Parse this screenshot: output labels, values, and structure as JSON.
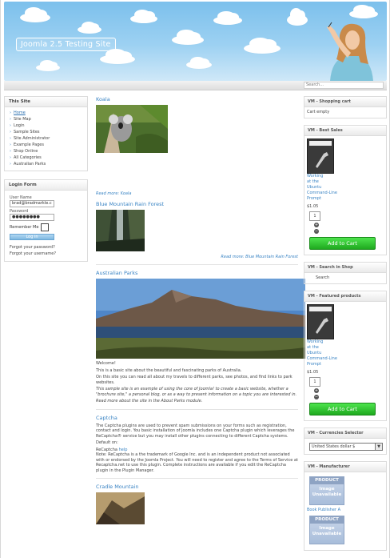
{
  "header": {
    "site_title": "Joomla 2.5 Testing Site",
    "search_placeholder": "Search..."
  },
  "left_sidebar": {
    "this_site": {
      "title": "This Site",
      "items": [
        "Home",
        "Site Map",
        "Login",
        "Sample Sites",
        "Site Administrator",
        "Example Pages",
        "Shop Online",
        "All Categories",
        "Australian Parks"
      ]
    },
    "login_form": {
      "title": "Login Form",
      "username_label": "User Name",
      "username_value": "brad@bradmarkle.c",
      "password_label": "Password",
      "password_value": "●●●●●●●●",
      "remember_label": "Remember Me",
      "login_button": "Log in",
      "forgot_password": "Forgot your password?",
      "forgot_username": "Forgot your username?"
    }
  },
  "main": {
    "koala": {
      "title": "Koala",
      "readmore": "Read more: Koala"
    },
    "blue_mountain": {
      "title": "Blue Mountain Rain Forest",
      "readmore": "Read more: Blue Mountain Rain Forest"
    },
    "australian_parks": {
      "title": "Australian Parks",
      "p1": "Welcome!",
      "p2": "This is a basic site about the beautiful and fascinating parks of Australia.",
      "p3": "On this site you can read all about my travels to different parks, see photos, and find links to park websites.",
      "p4": "This sample site is an example of using the core of Joomla! to create a basic website, whether a \"brochure site,\" a personal blog, or as a way to present information on a topic you are interested in.",
      "p5": "Read more about the site in the About Parks module."
    },
    "captcha": {
      "title": "Captcha",
      "p1": "The Captcha plugins are used to prevent spam submissions on your forms such as registration, contact and login. You basic installation of Joomla includes one Captcha plugin which leverages the ReCaptcha® service but you may install other plugins connecting to different Captcha systems.",
      "p2": "Default on:",
      "p3_label": "ReCaptcha",
      "p3_link": "help",
      "p4": "Note: ReCaptcha is a the trademark of Google Inc. and is an independent product not associated with or endorsed by the Joomla Project. You will need to register and agree to the Terms of Service at Recaptcha.net to use this plugin. Complete instructions are available if you edit the ReCaptcha plugin in the Plugin Manager."
    },
    "cradle_mountain": {
      "title": "Cradle Mountain"
    }
  },
  "right_sidebar": {
    "cart": {
      "title": "VM - Shopping cart",
      "status": "Cart empty"
    },
    "best_sales": {
      "title": "VM - Best Sales",
      "product_name_lines": [
        "Working",
        "at the",
        "Ubuntu",
        "Command-Line",
        "Prompt"
      ],
      "price": "$1.05",
      "qty": "1",
      "add_to_cart": "Add to Cart"
    },
    "search_shop": {
      "title": "VM - Search in Shop",
      "label": "Search"
    },
    "featured": {
      "title": "VM - Featured products",
      "product_name_lines": [
        "Working",
        "at the",
        "Ubuntu",
        "Command-Line",
        "Prompt"
      ],
      "price": "$1.05",
      "qty": "1",
      "add_to_cart": "Add to Cart"
    },
    "currencies": {
      "title": "VM - Currencies Selector",
      "selected": "United States dollar $"
    },
    "manufacturer": {
      "title": "VM - Manufacturer",
      "noimg_top": "PRODUCT",
      "noimg_line1": "Image",
      "noimg_line2": "Unavailable",
      "publisher_a": "Book Publisher A"
    }
  },
  "colors": {
    "link": "#3a84c4",
    "header_sky": "#9dd1f2",
    "add_to_cart": "#2fc02f"
  }
}
